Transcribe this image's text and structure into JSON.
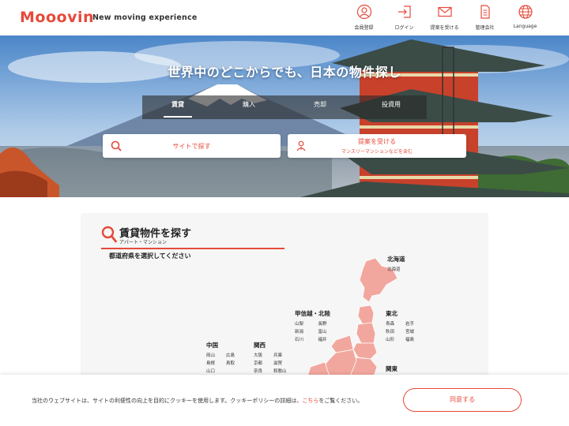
{
  "brand": {
    "logo": "Mooovin",
    "tagline": "New moving experience",
    "accent_color": "#e64a3a"
  },
  "nav": [
    {
      "label": "会員登録",
      "icon": "user-circle-icon"
    },
    {
      "label": "ログイン",
      "icon": "login-icon"
    },
    {
      "label": "提案を受ける",
      "icon": "mail-icon"
    },
    {
      "label": "管理会社",
      "icon": "document-icon"
    },
    {
      "label": "Language",
      "icon": "globe-icon"
    }
  ],
  "hero": {
    "title": "世界中のどこからでも、日本の物件探し",
    "tabs": [
      "賃貸",
      "購入",
      "売却",
      "投資用"
    ],
    "active_tab": "賃貸",
    "search_button": "サイトで探す",
    "proposal_button": "提案を受ける",
    "proposal_sub": "マンスリーマンションなどを含む"
  },
  "section": {
    "title": "賃貸物件を探す",
    "subtitle": "アパート・マンション",
    "prompt": "都道府県を選択してください"
  },
  "regions": {
    "hokkaido": {
      "name": "北海道",
      "prefs": [
        "北海道"
      ]
    },
    "tohoku": {
      "name": "東北",
      "prefs": [
        "青森",
        "秋田",
        "山形",
        "岩手",
        "宮城",
        "福島"
      ]
    },
    "koshinetsu": {
      "name": "甲信越・北陸",
      "prefs": [
        "山梨",
        "新潟",
        "石川",
        "長野",
        "富山",
        "福井"
      ]
    },
    "chugoku": {
      "name": "中国",
      "prefs": [
        "岡山",
        "島根",
        "山口",
        "広島",
        "鳥取"
      ]
    },
    "kansai": {
      "name": "関西",
      "prefs": [
        "大阪",
        "京都",
        "奈良",
        "兵庫",
        "滋賀",
        "和歌山"
      ]
    },
    "kanto": {
      "name": "関東",
      "prefs": []
    }
  },
  "cookie": {
    "text_before": "当社のウェブサイトは、サイトの利便性の向上を目的にクッキーを使用します。クッキーポリシーの詳細は、",
    "link": "こちら",
    "text_after": "をご覧ください。",
    "agree": "同意する"
  }
}
